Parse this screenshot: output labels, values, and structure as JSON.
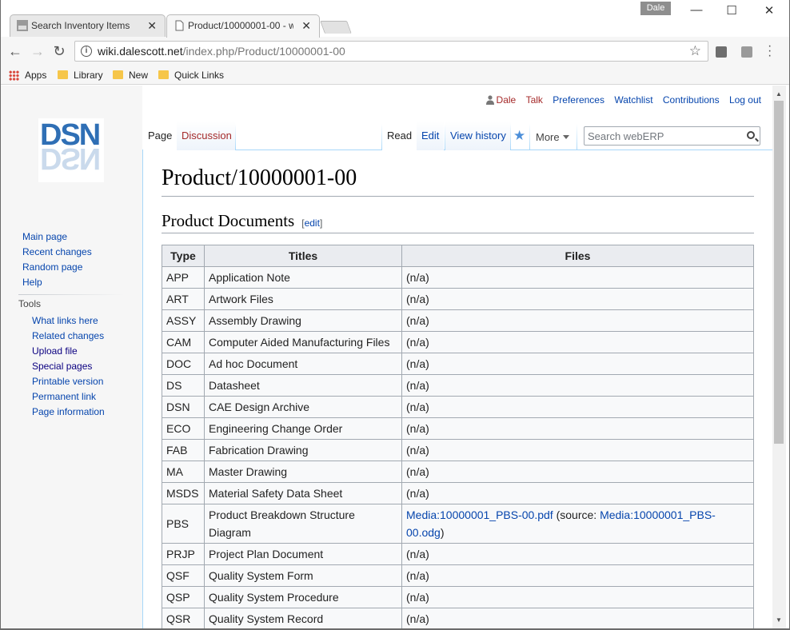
{
  "browser": {
    "tabs": [
      {
        "title": "Search Inventory Items",
        "active": false
      },
      {
        "title": "Product/10000001-00 - w",
        "active": true
      }
    ],
    "profile_name": "Dale",
    "window_controls": {
      "minimize": "—",
      "maximize": "☐",
      "close": "✕"
    },
    "url_host": "wiki.dalescott.net",
    "url_path": "/index.php/Product/10000001-00",
    "bookmarks": [
      "Apps",
      "Library",
      "New",
      "Quick Links"
    ]
  },
  "personal": {
    "user": "Dale",
    "talk": "Talk",
    "preferences": "Preferences",
    "watchlist": "Watchlist",
    "contributions": "Contributions",
    "logout": "Log out"
  },
  "logo_text": "DSN",
  "namespaces": {
    "page": "Page",
    "discussion": "Discussion"
  },
  "views": {
    "read": "Read",
    "edit": "Edit",
    "history": "View history",
    "more": "More"
  },
  "search": {
    "placeholder": "Search webERP"
  },
  "navigation": [
    "Main page",
    "Recent changes",
    "Random page",
    "Help"
  ],
  "tools": {
    "heading": "Tools",
    "items": [
      "What links here",
      "Related changes",
      "Upload file",
      "Special pages",
      "Printable version",
      "Permanent link",
      "Page information"
    ]
  },
  "page": {
    "title": "Product/10000001-00",
    "section_title": "Product Documents",
    "edit_link": "edit",
    "table": {
      "headers": [
        "Type",
        "Titles",
        "Files"
      ],
      "rows": [
        {
          "type": "APP",
          "title": "Application Note",
          "files": "(n/a)"
        },
        {
          "type": "ART",
          "title": "Artwork Files",
          "files": "(n/a)"
        },
        {
          "type": "ASSY",
          "title": "Assembly Drawing",
          "files": "(n/a)"
        },
        {
          "type": "CAM",
          "title": "Computer Aided Manufacturing Files",
          "files": "(n/a)"
        },
        {
          "type": "DOC",
          "title": "Ad hoc Document",
          "files": "(n/a)"
        },
        {
          "type": "DS",
          "title": "Datasheet",
          "files": "(n/a)"
        },
        {
          "type": "DSN",
          "title": "CAE Design Archive",
          "files": "(n/a)"
        },
        {
          "type": "ECO",
          "title": "Engineering Change Order",
          "files": "(n/a)"
        },
        {
          "type": "FAB",
          "title": "Fabrication Drawing",
          "files": "(n/a)"
        },
        {
          "type": "MA",
          "title": "Master Drawing",
          "files": "(n/a)"
        },
        {
          "type": "MSDS",
          "title": "Material Safety Data Sheet",
          "files": "(n/a)"
        },
        {
          "type": "PBS",
          "title": "Product Breakdown Structure Diagram",
          "file_link": "Media:10000001_PBS-00.pdf",
          "file_source_prefix": "(source: ",
          "file_source_link": "Media:10000001_PBS-00.odg",
          "file_source_suffix": ")"
        },
        {
          "type": "PRJP",
          "title": "Project Plan Document",
          "files": "(n/a)"
        },
        {
          "type": "QSF",
          "title": "Quality System Form",
          "files": "(n/a)"
        },
        {
          "type": "QSP",
          "title": "Quality System Procedure",
          "files": "(n/a)"
        },
        {
          "type": "QSR",
          "title": "Quality System Record",
          "files": "(n/a)"
        }
      ]
    }
  },
  "colors": {
    "link": "#0645ad",
    "redlink": "#a52a2a",
    "border": "#a7d7f9"
  }
}
